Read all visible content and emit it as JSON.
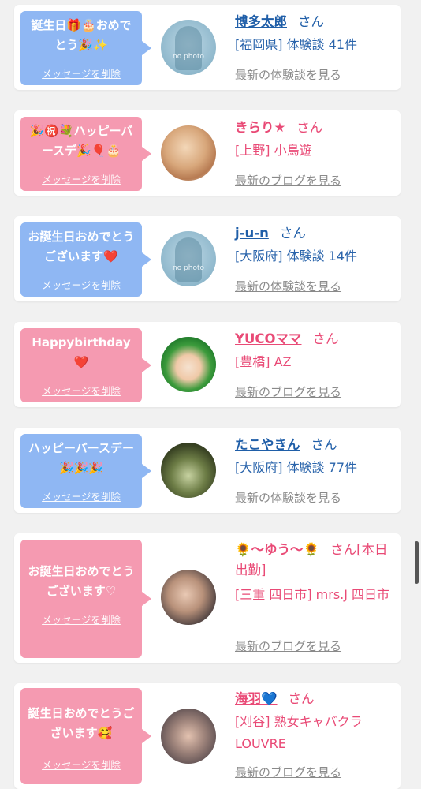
{
  "cards": [
    {
      "message": "誕生日🎁🎂おめでとう🎉✨",
      "delete_label": "メッセージを削除",
      "avatar": "no-photo",
      "avatar_text": "no photo",
      "name": "博多太郎",
      "san": "さん",
      "meta": "[福岡県] 体験談 41件",
      "link": "最新の体験談を見る",
      "theme": "blue"
    },
    {
      "message": "🎉㊗️💐ハッピーバースデ🎉🎈🎂",
      "delete_label": "メッセージを削除",
      "avatar": "photo",
      "name": "きらり★",
      "san": "さん",
      "meta": "[上野] 小鳥遊",
      "link": "最新のブログを見る",
      "theme": "pink"
    },
    {
      "message": "お誕生日おめでとうございます❤️",
      "delete_label": "メッセージを削除",
      "avatar": "no-photo",
      "avatar_text": "no photo",
      "name": "j-u-n",
      "san": "さん",
      "meta": "[大阪府] 体験談 14件",
      "link": "最新の体験談を見る",
      "theme": "blue"
    },
    {
      "message": "Happybirthday❤️",
      "delete_label": "メッセージを削除",
      "avatar": "photo",
      "name": "YUCOママ",
      "san": "さん",
      "meta": "[豊橋] AZ",
      "link": "最新のブログを見る",
      "theme": "pink"
    },
    {
      "message": "ハッピーバースデー🎉🎉🎉",
      "delete_label": "メッセージを削除",
      "avatar": "photo",
      "name": "たこやきん",
      "san": "さん",
      "meta": "[大阪府] 体験談 77件",
      "link": "最新の体験談を見る",
      "theme": "blue"
    },
    {
      "message": "お誕生日おめでとうございます♡",
      "delete_label": "メッセージを削除",
      "avatar": "photo",
      "name": "🌻〜ゆう〜🌻",
      "san": "さん[本日出勤]",
      "meta": "[三重 四日市] mrs.J 四日市",
      "link": "最新のブログを見る",
      "theme": "pink"
    },
    {
      "message": "誕生日おめでとうございます🥰",
      "delete_label": "メッセージを削除",
      "avatar": "photo",
      "name": "海羽💙",
      "san": "さん",
      "meta": "[刈谷] 熟女キャバクラLOUVRE",
      "link": "最新のブログを見る",
      "theme": "pink"
    }
  ],
  "colors": {
    "blue_bubble": "#8fb7f3",
    "pink_bubble": "#f59ab1",
    "blue_text": "#1f5ea8",
    "pink_text": "#e94a76",
    "background": "#f1f1f1"
  }
}
